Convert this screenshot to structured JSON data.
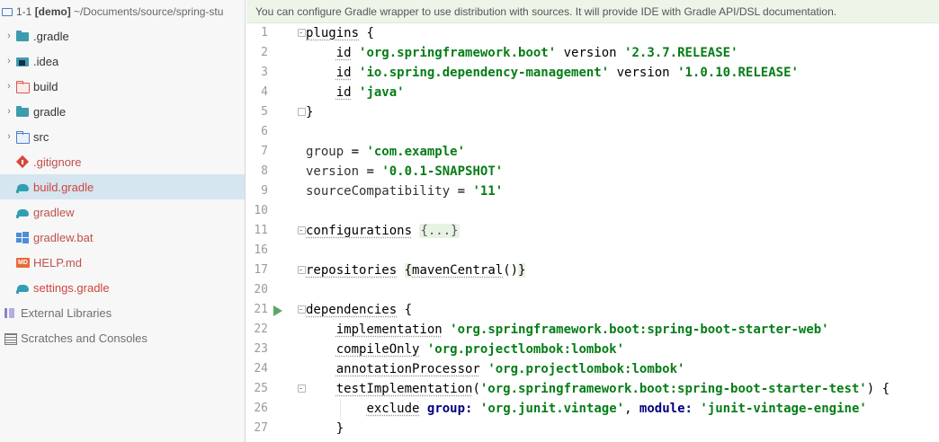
{
  "project": {
    "header": {
      "root": "1-1",
      "module": "[demo]",
      "path": "~/Documents/source/spring-stu"
    },
    "items": [
      {
        "label": ".gradle",
        "icon": "folder-teal-icon",
        "expandable": true,
        "style": "normal"
      },
      {
        "label": ".idea",
        "icon": "idea-folder-icon",
        "expandable": true,
        "style": "normal"
      },
      {
        "label": "build",
        "icon": "excluded-folder-icon",
        "expandable": true,
        "style": "excluded"
      },
      {
        "label": "gradle",
        "icon": "folder-teal-icon",
        "expandable": true,
        "style": "normal"
      },
      {
        "label": "src",
        "icon": "source-folder-icon",
        "expandable": true,
        "style": "normal"
      },
      {
        "label": ".gitignore",
        "icon": "git-icon",
        "expandable": false,
        "style": "gitignored"
      },
      {
        "label": "build.gradle",
        "icon": "gradle-icon",
        "expandable": false,
        "style": "modified",
        "selected": true
      },
      {
        "label": "gradlew",
        "icon": "gradle-icon",
        "expandable": false,
        "style": "normal"
      },
      {
        "label": "gradlew.bat",
        "icon": "windows-icon",
        "expandable": false,
        "style": "normal"
      },
      {
        "label": "HELP.md",
        "icon": "markdown-icon",
        "expandable": false,
        "style": "normal"
      },
      {
        "label": "settings.gradle",
        "icon": "gradle-icon",
        "expandable": false,
        "style": "modified"
      },
      {
        "label": "External Libraries",
        "icon": "libraries-icon",
        "expandable": false,
        "style": "muted"
      },
      {
        "label": "Scratches and Consoles",
        "icon": "scratches-icon",
        "expandable": false,
        "style": "muted"
      }
    ]
  },
  "editor": {
    "banner": "You can configure Gradle wrapper to use distribution with sources. It will provide IDE with Gradle API/DSL documentation.",
    "lines": [
      {
        "num": "1"
      },
      {
        "num": "2"
      },
      {
        "num": "3"
      },
      {
        "num": "4"
      },
      {
        "num": "5"
      },
      {
        "num": "6"
      },
      {
        "num": "7"
      },
      {
        "num": "8"
      },
      {
        "num": "9"
      },
      {
        "num": "10"
      },
      {
        "num": "11"
      },
      {
        "num": "16"
      },
      {
        "num": "17"
      },
      {
        "num": "20"
      },
      {
        "num": "21"
      },
      {
        "num": "22"
      },
      {
        "num": "23"
      },
      {
        "num": "24"
      },
      {
        "num": "25"
      },
      {
        "num": "26"
      },
      {
        "num": "27"
      }
    ],
    "code": {
      "plugins": "plugins",
      "id": "id",
      "boot_plugin": "'org.springframework.boot'",
      "version_kw": "version",
      "boot_version": "'2.3.7.RELEASE'",
      "dm_plugin": "'io.spring.dependency-management'",
      "dm_version": "'1.0.10.RELEASE'",
      "java_plugin": "'java'",
      "group_kw": "group",
      "group_val": "'com.example'",
      "version_val": "'0.0.1-SNAPSHOT'",
      "source_compat_kw": "sourceCompatibility",
      "source_compat_val": "'11'",
      "configurations": "configurations",
      "folded": "{...}",
      "repositories": "repositories",
      "maven_central": "mavenCentral",
      "dependencies": "dependencies",
      "implementation": "implementation",
      "dep_web": "'org.springframework.boot:spring-boot-starter-web'",
      "compile_only": "compileOnly",
      "dep_lombok": "'org.projectlombok:lombok'",
      "annotation_processor": "annotationProcessor",
      "test_implementation": "testImplementation",
      "dep_test": "'org.springframework.boot:spring-boot-starter-test'",
      "exclude": "exclude",
      "group_label": "group:",
      "junit_group": "'org.junit.vintage'",
      "module_label": "module:",
      "junit_module": "'junit-vintage-engine'"
    }
  },
  "colors": {
    "string": "#067d17",
    "selection": "#d5e6f0",
    "banner": "#edf5e9",
    "modified": "#d1453b",
    "run_gutter": "#59a869"
  }
}
